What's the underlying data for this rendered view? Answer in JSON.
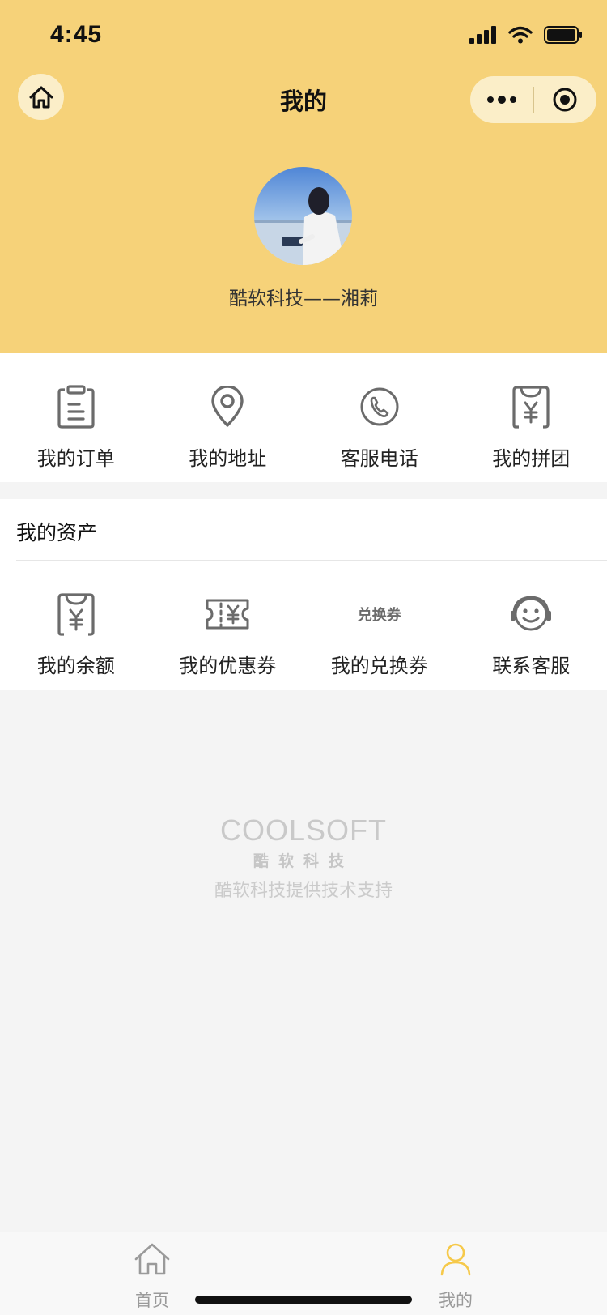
{
  "status_bar": {
    "time": "4:45"
  },
  "nav": {
    "title": "我的"
  },
  "profile": {
    "name": "酷软科技——湘莉"
  },
  "quick_menu": [
    {
      "label": "我的订单",
      "icon": "clipboard-icon"
    },
    {
      "label": "我的地址",
      "icon": "location-pin-icon"
    },
    {
      "label": "客服电话",
      "icon": "phone-icon"
    },
    {
      "label": "我的拼团",
      "icon": "yuan-card-icon"
    }
  ],
  "assets": {
    "title": "我的资产",
    "items": [
      {
        "label": "我的余额",
        "icon": "balance-icon"
      },
      {
        "label": "我的优惠券",
        "icon": "coupon-icon"
      },
      {
        "label": "我的兑换券",
        "icon": "exchange-voucher-icon",
        "icon_text": "兑换券"
      },
      {
        "label": "联系客服",
        "icon": "customer-service-icon"
      }
    ]
  },
  "footer": {
    "logo": "COOLSOFT",
    "brand_cn": "酷软科技",
    "support": "酷软科技提供技术支持"
  },
  "tabs": [
    {
      "label": "首页",
      "icon": "home-icon"
    },
    {
      "label": "我的",
      "icon": "user-icon"
    }
  ],
  "colors": {
    "header": "#f6d279",
    "active_tab": "#f6c94a",
    "inactive_tab": "#9a9a9a"
  }
}
